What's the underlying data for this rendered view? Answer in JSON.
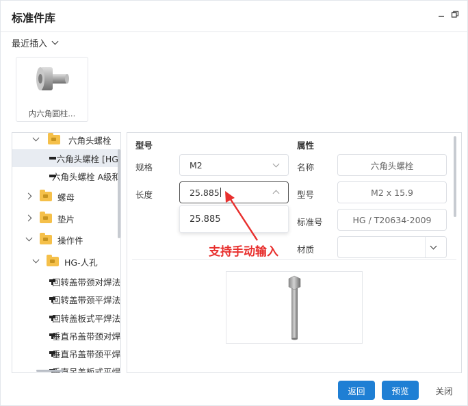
{
  "window": {
    "title": "标准件库"
  },
  "recent": {
    "label": "最近插入",
    "items": [
      {
        "caption": "内六角圆柱..."
      }
    ]
  },
  "tree": {
    "items": [
      {
        "label": "六角头螺栓",
        "type": "folder",
        "expanded": true
      },
      {
        "label": "六角头螺栓 [HG",
        "type": "part",
        "selected": true
      },
      {
        "label": "六角头螺栓 A级和",
        "type": "part"
      },
      {
        "label": "螺母",
        "type": "folder",
        "expanded": false
      },
      {
        "label": "垫片",
        "type": "folder",
        "expanded": false
      },
      {
        "label": "操作件",
        "type": "folder",
        "expanded": true
      },
      {
        "label": "HG-人孔",
        "type": "folder",
        "expanded": true
      },
      {
        "label": "回转盖带颈对焊法",
        "type": "part"
      },
      {
        "label": "回转盖带颈平焊法",
        "type": "part"
      },
      {
        "label": "回转盖板式平焊法",
        "type": "part"
      },
      {
        "label": "垂直吊盖带颈对焊",
        "type": "part"
      },
      {
        "label": "垂直吊盖带颈平焊",
        "type": "part"
      },
      {
        "label": "垂直吊盖板式平焊",
        "type": "part"
      }
    ]
  },
  "model": {
    "section_title": "型号",
    "spec_label": "规格",
    "spec_value": "M2",
    "length_label": "长度",
    "length_value": "25.885",
    "dropdown_option": "25.885"
  },
  "properties": {
    "section_title": "属性",
    "name_label": "名称",
    "name_value": "六角头螺栓",
    "model_label": "型号",
    "model_value": "M2 x 15.9",
    "standard_label": "标准号",
    "standard_value": "HG / T20634-2009",
    "material_label": "材质",
    "material_value": ""
  },
  "annotation": {
    "text": "支持手动输入",
    "color": "#e8302e"
  },
  "buttons": {
    "back": "返回",
    "preview": "预览",
    "close": "关闭"
  },
  "colors": {
    "primary": "#1f7fd4",
    "annotation": "#e8302e",
    "folder": "#f5c04a"
  }
}
